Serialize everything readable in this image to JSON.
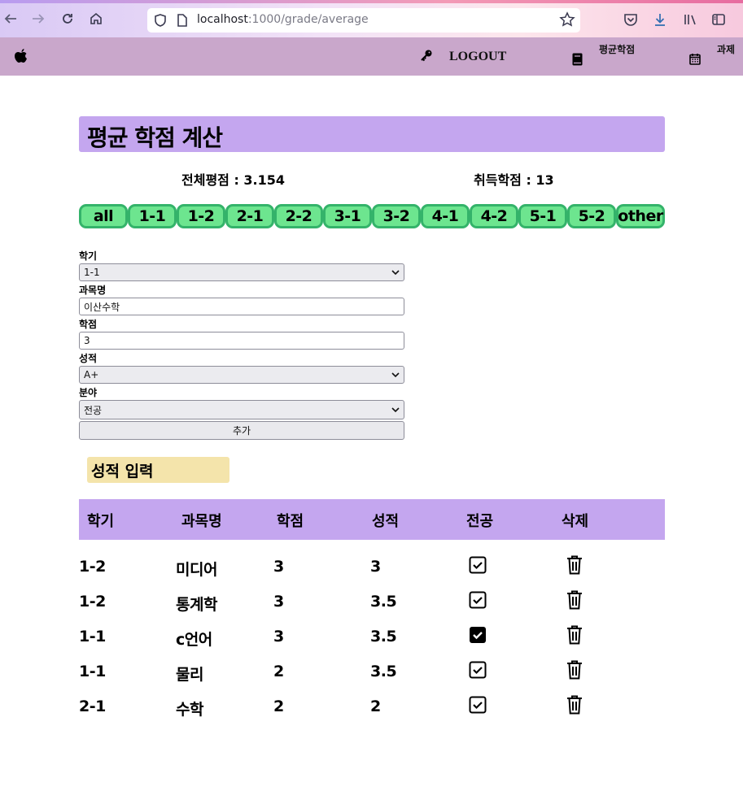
{
  "browser": {
    "url_host": "localhost",
    "url_path": ":1000/grade/average"
  },
  "header": {
    "logo_icon": "apple-icon",
    "logout_label": "LOGOUT",
    "avg_grade_label": "평균학점",
    "assignment_label": "과제"
  },
  "main": {
    "title": "평균 학점 계산",
    "overall_gpa": "전체평점 : 3.154",
    "earned_credits": "취득학점 : 13",
    "semester_tabs": [
      "all",
      "1-1",
      "1-2",
      "2-1",
      "2-2",
      "3-1",
      "3-2",
      "4-1",
      "4-2",
      "5-1",
      "5-2",
      "other"
    ]
  },
  "form": {
    "semester_label": "학기",
    "semester_value": "1-1",
    "course_label": "과목명",
    "course_value": "이산수학",
    "credit_label": "학점",
    "credit_value": "3",
    "grade_label": "성적",
    "grade_value": "A+",
    "field_label": "분야",
    "field_value": "전공",
    "add_label": "추가"
  },
  "section_title": "성적 입력",
  "table": {
    "headers": [
      "학기",
      "과목명",
      "학점",
      "성적",
      "전공",
      "삭제"
    ],
    "rows": [
      {
        "semester": "1-2",
        "course": "미디어",
        "credit": "3",
        "grade": "3",
        "major": "checked-outline"
      },
      {
        "semester": "1-2",
        "course": "통계학",
        "credit": "3",
        "grade": "3.5",
        "major": "checked-outline"
      },
      {
        "semester": "1-1",
        "course": "c언어",
        "credit": "3",
        "grade": "3.5",
        "major": "checked-filled"
      },
      {
        "semester": "1-1",
        "course": "물리",
        "credit": "2",
        "grade": "3.5",
        "major": "checked-outline"
      },
      {
        "semester": "2-1",
        "course": "수학",
        "credit": "2",
        "grade": "2",
        "major": "checked-outline"
      }
    ]
  },
  "colors": {
    "header_bg": "#c9a7cb",
    "title_bg": "#c4a6ef",
    "tab_bg": "#6de58f",
    "tab_border": "#34b36a",
    "section_chip_bg": "#f4e4ab"
  }
}
